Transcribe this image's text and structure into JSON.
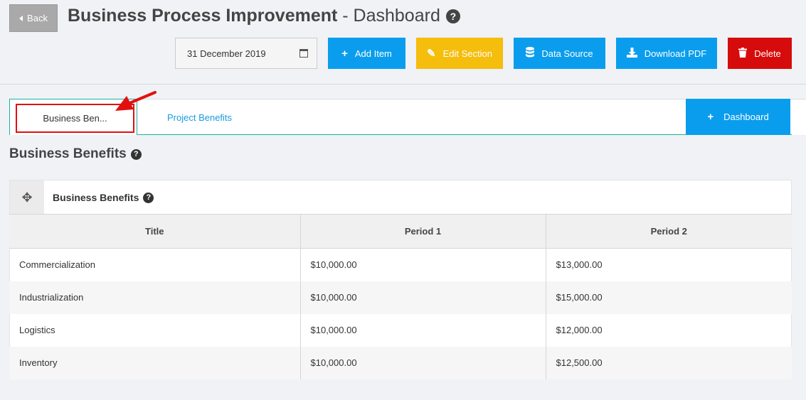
{
  "header": {
    "back_label": "Back",
    "title_bold": "Business Process Improvement",
    "title_rest": " - Dashboard",
    "help": "?"
  },
  "toolbar": {
    "date": "31 December 2019",
    "add_item": "Add Item",
    "edit_section": "Edit Section",
    "data_source": "Data Source",
    "download_pdf": "Download PDF",
    "delete": "Delete"
  },
  "tabs": {
    "active_label": "Business Ben...",
    "project_label": "Project Benefits",
    "dashboard_label": "Dashboard"
  },
  "section": {
    "title": "Business Benefits",
    "help": "?"
  },
  "panel": {
    "title": "Business Benefits",
    "help": "?",
    "table": {
      "columns": [
        "Title",
        "Period 1",
        "Period 2"
      ],
      "rows": [
        [
          "Commercialization",
          "$10,000.00",
          "$13,000.00"
        ],
        [
          "Industrialization",
          "$10,000.00",
          "$15,000.00"
        ],
        [
          "Logistics",
          "$10,000.00",
          "$12,000.00"
        ],
        [
          "Inventory",
          "$10,000.00",
          "$12,500.00"
        ]
      ]
    }
  },
  "colors": {
    "primary": "#0a9ded",
    "warning": "#f5bd0c",
    "danger": "#d60b0b",
    "tab_border": "#1ab2a2",
    "highlight": "#e21010"
  }
}
